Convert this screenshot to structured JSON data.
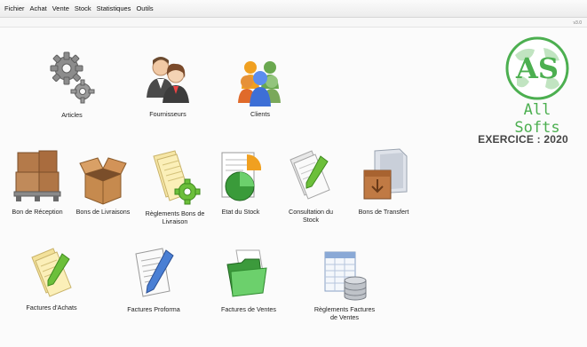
{
  "menu": [
    "Fichier",
    "Achat",
    "Vente",
    "Stock",
    "Statistiques",
    "Outils"
  ],
  "version": "v3.0",
  "logo": {
    "initials": "AS",
    "brand": "All Softs",
    "color": "#4caf50"
  },
  "exercise": "EXERCICE : 2020",
  "tiles": {
    "articles": "Articles",
    "fournisseurs": "Fournisseurs",
    "clients": "Clients",
    "bon_reception": "Bon de Réception",
    "bons_livraisons": "Bons de Livraisons",
    "reglements_bl": "Règlements Bons de Livraison",
    "etat_stock": "Etat du Stock",
    "consultation_stock": "Consultation du Stock",
    "bons_transfert": "Bons de Transfert",
    "factures_achats": "Factures d'Achats",
    "factures_proforma": "Factures Proforma",
    "factures_ventes": "Factures de Ventes",
    "reglements_factures": "Règlements Factures de Ventes"
  },
  "icons": {
    "articles": "gears-icon",
    "fournisseurs": "suppliers-icon",
    "clients": "clients-icon",
    "bon_reception": "pallet-boxes-icon",
    "bons_livraisons": "open-box-icon",
    "reglements_bl": "documents-gear-icon",
    "etat_stock": "report-chart-icon",
    "consultation_stock": "document-pen-icon",
    "bons_transfert": "folder-box-icon",
    "factures_achats": "notepad-pen-icon",
    "factures_proforma": "invoice-pen-icon",
    "factures_ventes": "green-folder-icon",
    "reglements_factures": "database-sheet-icon"
  }
}
